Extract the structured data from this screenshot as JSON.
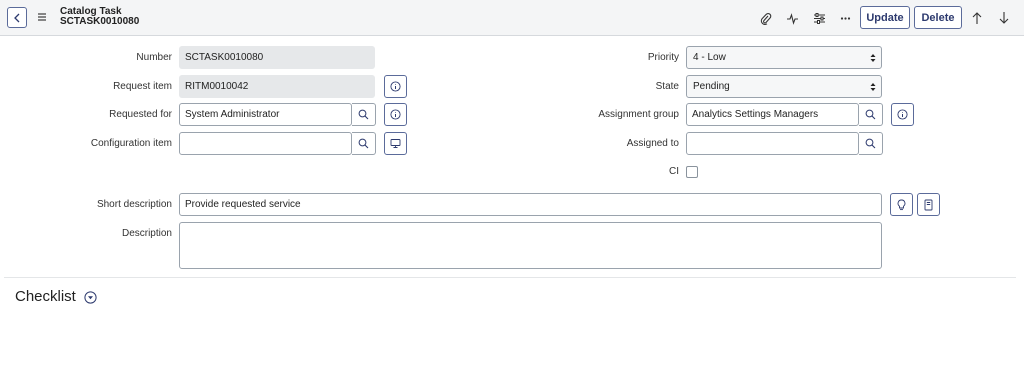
{
  "header": {
    "title": "Catalog Task",
    "record_number": "SCTASK0010080",
    "update_label": "Update",
    "delete_label": "Delete",
    "icons": [
      "back-icon",
      "menu-icon",
      "attachment-icon",
      "activity-icon",
      "settings-icon",
      "more-icon",
      "arrow-up-icon",
      "arrow-down-icon"
    ]
  },
  "form": {
    "number": {
      "label": "Number",
      "value": "SCTASK0010080"
    },
    "request_item": {
      "label": "Request item",
      "value": "RITM0010042"
    },
    "requested_for": {
      "label": "Requested for",
      "value": "System Administrator"
    },
    "configuration_item": {
      "label": "Configuration item",
      "value": ""
    },
    "priority": {
      "label": "Priority",
      "value": "4 - Low"
    },
    "state": {
      "label": "State",
      "value": "Pending"
    },
    "assignment_group": {
      "label": "Assignment group",
      "value": "Analytics Settings Managers"
    },
    "assigned_to": {
      "label": "Assigned to",
      "value": ""
    },
    "ci": {
      "label": "CI",
      "checked": false
    },
    "short_description": {
      "label": "Short description",
      "value": "Provide requested service"
    },
    "description": {
      "label": "Description",
      "value": ""
    }
  },
  "checklist": {
    "title": "Checklist"
  },
  "colors": {
    "accent": "#5b6b9a",
    "header_bg": "#f4f5f6",
    "readonly_bg": "#e6e8ea"
  }
}
